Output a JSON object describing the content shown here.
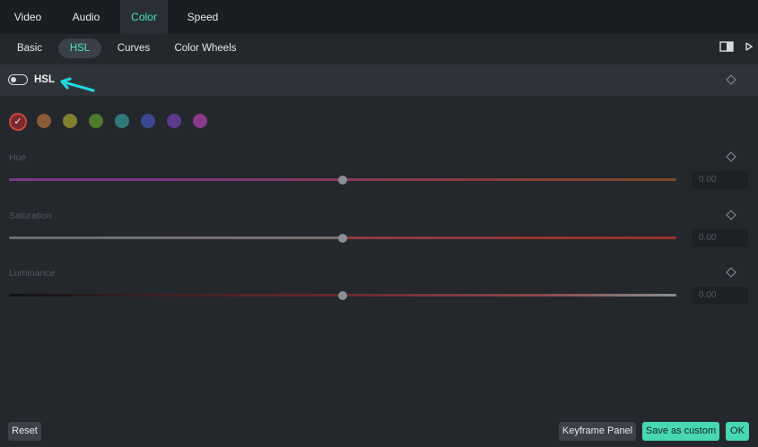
{
  "top_tabs": [
    {
      "label": "Video"
    },
    {
      "label": "Audio"
    },
    {
      "label": "Color"
    },
    {
      "label": "Speed"
    }
  ],
  "active_top_tab": "Color",
  "sub_tabs": [
    {
      "label": "Basic"
    },
    {
      "label": "HSL"
    },
    {
      "label": "Curves"
    },
    {
      "label": "Color Wheels"
    }
  ],
  "active_sub_tab": "HSL",
  "hsl": {
    "title": "HSL",
    "enabled": false
  },
  "swatches": [
    {
      "name": "red",
      "color": "#b23a3a",
      "selected": true
    },
    {
      "name": "orange",
      "color": "#8a5a34"
    },
    {
      "name": "yellow",
      "color": "#7f7f30"
    },
    {
      "name": "green",
      "color": "#4f7a2c"
    },
    {
      "name": "aqua",
      "color": "#2f7a78"
    },
    {
      "name": "blue",
      "color": "#3a4790"
    },
    {
      "name": "purple",
      "color": "#5b3a8c"
    },
    {
      "name": "magenta",
      "color": "#8a3a8a"
    }
  ],
  "sliders": [
    {
      "label": "Hue",
      "value": "0.00",
      "position": 0.5
    },
    {
      "label": "Saturation",
      "value": "0.00",
      "position": 0.5
    },
    {
      "label": "Luminance",
      "value": "0.00",
      "position": 0.5
    }
  ],
  "buttons": {
    "reset": "Reset",
    "keyframe_panel": "Keyframe Panel",
    "save_as_custom": "Save as custom",
    "ok": "OK"
  },
  "colors": {
    "accent": "#4fe0c8",
    "button_green": "#47d7b4",
    "annotation_arrow": "#22d6e0"
  }
}
